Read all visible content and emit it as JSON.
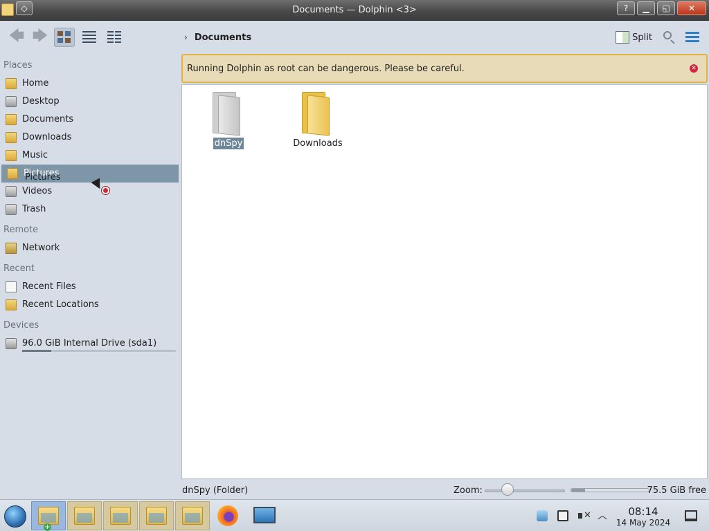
{
  "window": {
    "title": "Documents — Dolphin <3>",
    "help_label": "?",
    "close_label": "✕"
  },
  "toolbar": {
    "back_icon": "arrow-left-icon",
    "forward_icon": "arrow-right-icon",
    "views": [
      "icons",
      "details",
      "compact"
    ],
    "active_view": "icons"
  },
  "breadcrumb": {
    "arrow": "›",
    "current": "Documents"
  },
  "actions": {
    "split_label": "Split"
  },
  "sidebar": {
    "places_header": "Places",
    "places": [
      {
        "label": "Home",
        "icon": "home-folder-icon"
      },
      {
        "label": "Desktop",
        "icon": "desktop-icon"
      },
      {
        "label": "Documents",
        "icon": "documents-folder-icon"
      },
      {
        "label": "Downloads",
        "icon": "downloads-folder-icon"
      },
      {
        "label": "Music",
        "icon": "music-folder-icon"
      },
      {
        "label": "Pictures",
        "icon": "pictures-folder-icon",
        "selected": true
      },
      {
        "label": "Videos",
        "icon": "videos-folder-icon"
      },
      {
        "label": "Trash",
        "icon": "trash-icon"
      }
    ],
    "drag_ghost": "Pictures",
    "remote_header": "Remote",
    "remote": [
      {
        "label": "Network",
        "icon": "network-folder-icon"
      }
    ],
    "recent_header": "Recent",
    "recent": [
      {
        "label": "Recent Files",
        "icon": "recent-files-icon"
      },
      {
        "label": "Recent Locations",
        "icon": "recent-locations-icon"
      }
    ],
    "devices_header": "Devices",
    "devices": [
      {
        "label": "96.0 GiB Internal Drive (sda1)",
        "icon": "drive-icon",
        "usage_fraction": 0.19
      }
    ]
  },
  "warning": {
    "message": "Running Dolphin as root can be dangerous. Please be careful.",
    "close_icon": "close-circle-icon",
    "accent": "#e0b24a"
  },
  "files": [
    {
      "name": "dnSpy",
      "icon": "gray-folder-icon",
      "selected": true
    },
    {
      "name": "Downloads",
      "icon": "yellow-folder-icon",
      "selected": false
    }
  ],
  "status": {
    "info": "dnSpy (Folder)",
    "zoom_label": "Zoom:",
    "free_space": "75.5 GiB free"
  },
  "taskbar": {
    "clock_time": "08:14",
    "clock_date": "14 May 2024",
    "tray_icons": [
      "network-monitor-icon",
      "clipboard-icon",
      "volume-muted-icon"
    ],
    "expand_icon": "chevron-up-icon"
  }
}
